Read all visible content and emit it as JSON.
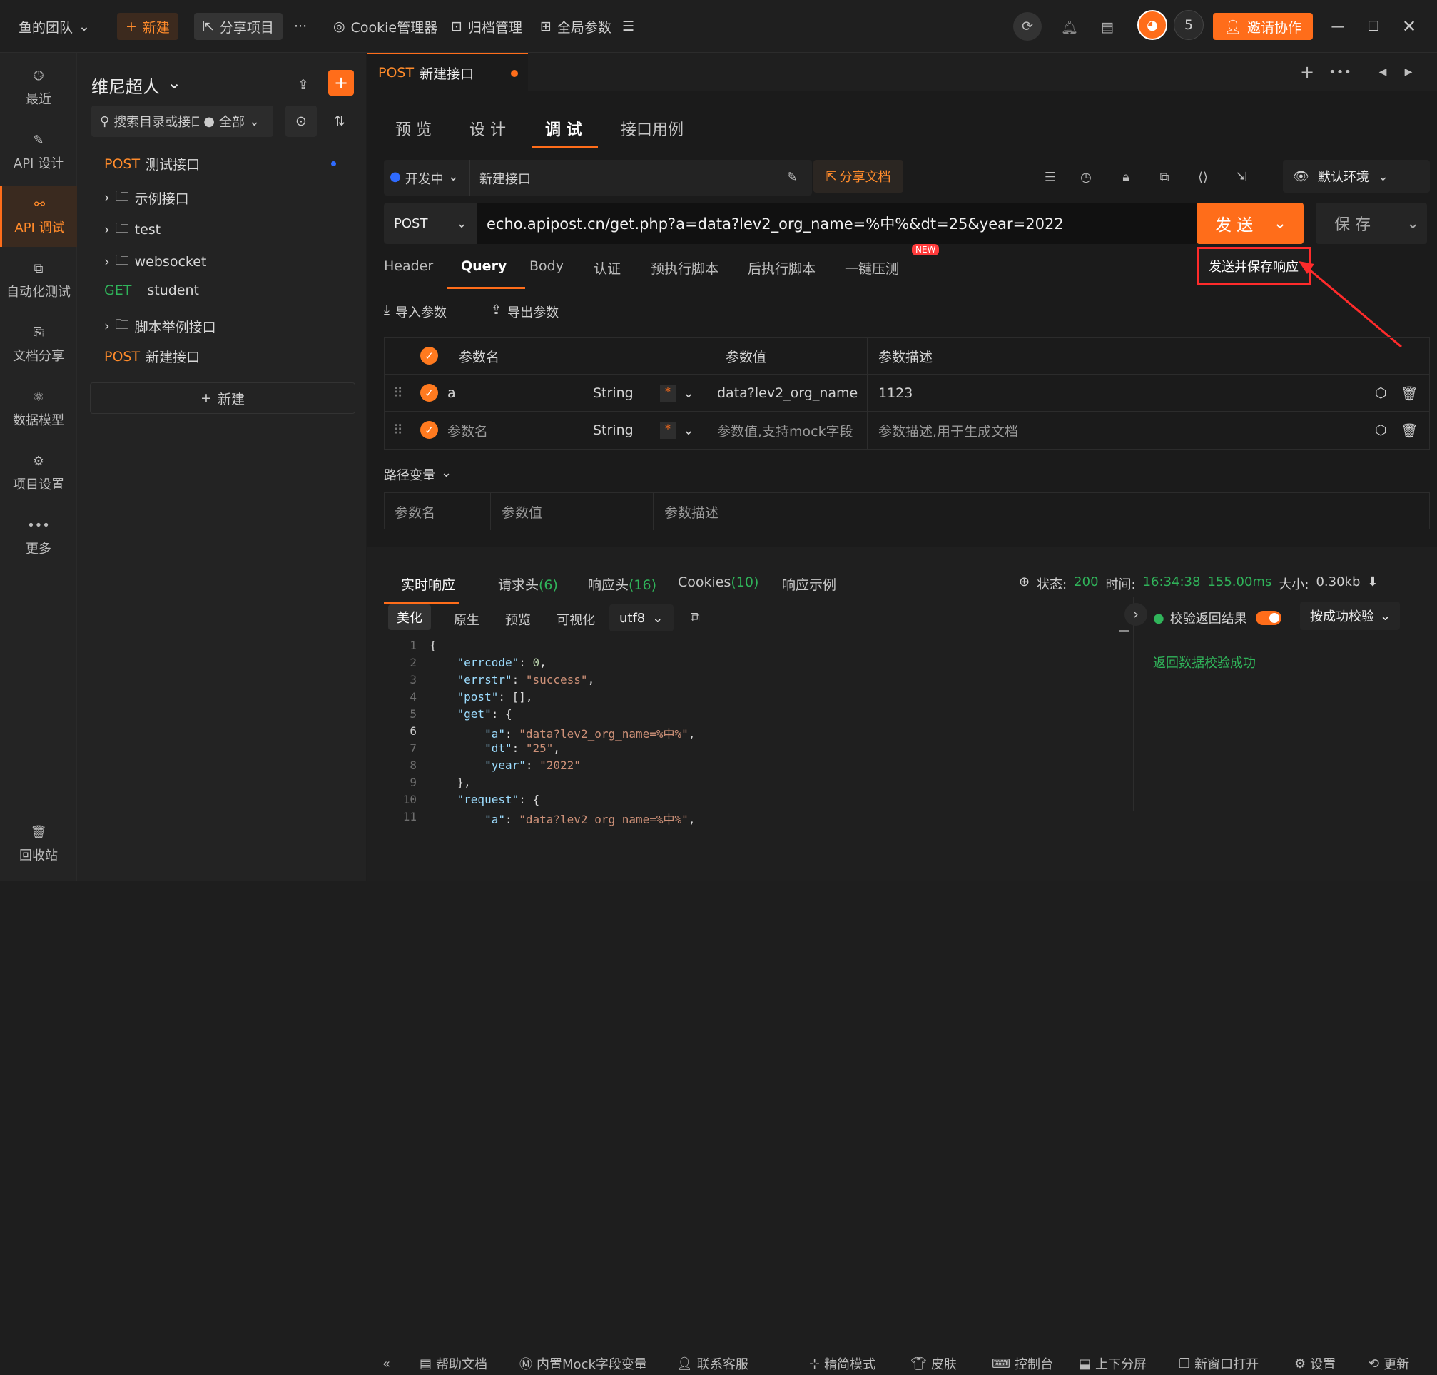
{
  "app": {
    "team": "鱼的团队",
    "new_btn": "新建",
    "share_project": "分享项目",
    "more": "···",
    "cookie": "Cookie管理器",
    "archive": "归档管理",
    "global": "全局参数",
    "members_count": "5",
    "invite": "邀请协作"
  },
  "left_nav": [
    {
      "label": "最近",
      "icon": "clock-icon"
    },
    {
      "label": "API 设计",
      "icon": "edit-icon"
    },
    {
      "label": "API 调试",
      "icon": "link-icon"
    },
    {
      "label": "自动化测试",
      "icon": "flow-icon"
    },
    {
      "label": "文档分享",
      "icon": "doc-icon"
    },
    {
      "label": "数据模型",
      "icon": "model-icon"
    },
    {
      "label": "项目设置",
      "icon": "settings-icon"
    },
    {
      "label": "更多",
      "icon": "more-icon"
    },
    {
      "label": "回收站",
      "icon": "trash-icon"
    }
  ],
  "sidebar": {
    "project": "维尼超人",
    "search_placeholder": "搜索目录或接口",
    "filter": "全部",
    "items": [
      {
        "method": "POST",
        "name": "测试接口"
      },
      {
        "method": "",
        "name": "示例接口"
      },
      {
        "method": "",
        "name": "test"
      },
      {
        "method": "",
        "name": "websocket"
      },
      {
        "method": "GET",
        "name": "student"
      },
      {
        "method": "",
        "name": "脚本举例接口"
      },
      {
        "method": "POST",
        "name": "新建接口"
      }
    ],
    "new_label": "新建"
  },
  "tab": {
    "method": "POST",
    "name": "新建接口"
  },
  "subtabs": [
    "预 览",
    "设 计",
    "调 试",
    "接口用例"
  ],
  "toolbar": {
    "status": "开发中",
    "name": "新建接口",
    "share_doc": "分享文档",
    "env": "默认环境"
  },
  "request": {
    "method": "POST",
    "url": "echo.apipost.cn/get.php?a=data?lev2_org_name=%中%&dt=25&year=2022",
    "send": "发 送",
    "save": "保 存",
    "dropdown_item": "发送并保存响应"
  },
  "param_tabs": [
    "Header",
    "Query",
    "Body",
    "认证",
    "预执行脚本",
    "后执行脚本",
    "一键压测"
  ],
  "new_badge": "NEW",
  "import": "导入参数",
  "export": "导出参数",
  "query_headers": {
    "name": "参数名",
    "value": "参数值",
    "desc": "参数描述"
  },
  "query_rows": [
    {
      "name": "a",
      "type": "String",
      "value": "data?lev2_org_name",
      "desc": "1123"
    },
    {
      "name": "参数名",
      "type": "String",
      "value": "参数值,支持mock字段",
      "desc": "参数描述,用于生成文档"
    }
  ],
  "required_mark": "*",
  "path_vars": {
    "title": "路径变量",
    "h1": "参数名",
    "h2": "参数值",
    "h3": "参数描述"
  },
  "resp_tabs": {
    "t1": "实时响应",
    "t2": "请求头",
    "c2": "(6)",
    "t3": "响应头",
    "c3": "(16)",
    "t4": "Cookies",
    "c4": "(10)",
    "t5": "响应示例"
  },
  "status": {
    "label": "状态:",
    "code": "200",
    "time_label": "时间:",
    "time": "16:34:38",
    "ms": "155.00ms",
    "size_label": "大小:",
    "size": "0.30kb"
  },
  "view_tabs": [
    "美化",
    "原生",
    "预览",
    "可视化"
  ],
  "encoding": "utf8",
  "validate": {
    "label": "校验返回结果",
    "mode": "按成功校验",
    "result": "返回数据校验成功"
  },
  "code_lines": [
    "{",
    "    \"errcode\": 0,",
    "    \"errstr\": \"success\",",
    "    \"post\": [],",
    "    \"get\": {",
    "        \"a\": \"data?lev2_org_name=%中%\",",
    "        \"dt\": \"25\",",
    "        \"year\": \"2022\"",
    "    },",
    "    \"request\": {",
    "        \"a\": \"data?lev2_org_name=%中%\","
  ],
  "bottom": [
    "帮助文档",
    "内置Mock字段变量",
    "联系客服",
    "精简模式",
    "皮肤",
    "控制台",
    "上下分屏",
    "新窗口打开",
    "设置",
    "更新"
  ],
  "colors": {
    "accent": "#ff6d1a",
    "green": "#30b45a",
    "red": "#ff2b2b"
  }
}
